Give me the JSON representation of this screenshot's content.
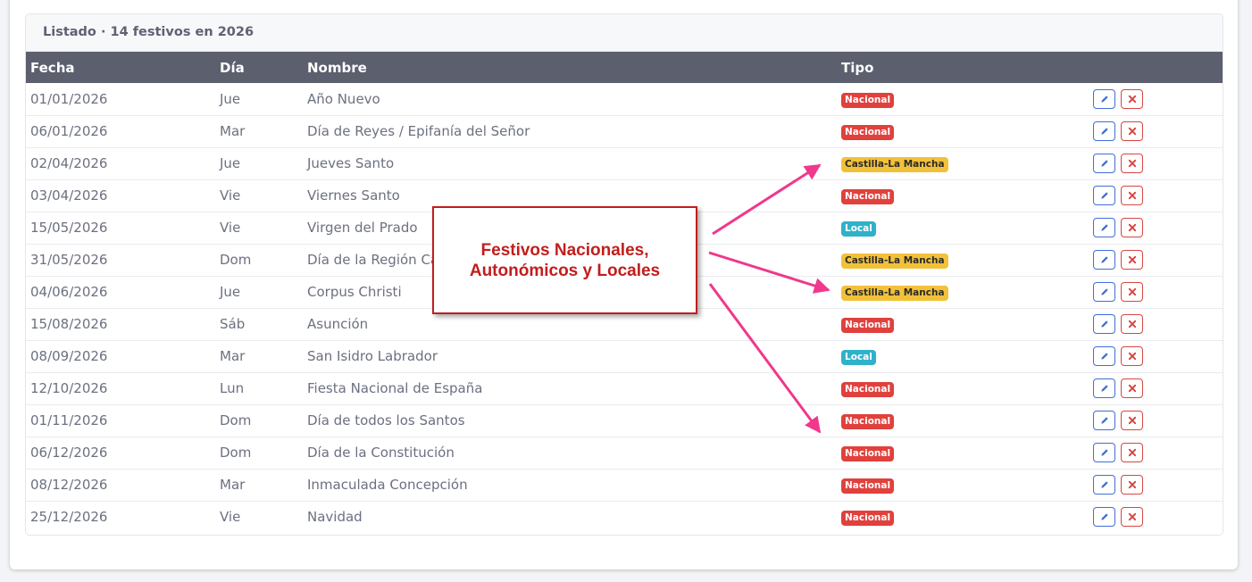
{
  "card": {
    "title": "Listado · 14 festivos en 2026"
  },
  "table": {
    "headers": {
      "fecha": "Fecha",
      "dia": "Día",
      "nombre": "Nombre",
      "tipo": "Tipo"
    },
    "rows": [
      {
        "fecha": "01/01/2026",
        "dia": "Jue",
        "nombre": "Año Nuevo",
        "tipo": "Nacional",
        "tipo_kind": "nacional"
      },
      {
        "fecha": "06/01/2026",
        "dia": "Mar",
        "nombre": "Día de Reyes / Epifanía del Señor",
        "tipo": "Nacional",
        "tipo_kind": "nacional"
      },
      {
        "fecha": "02/04/2026",
        "dia": "Jue",
        "nombre": "Jueves Santo",
        "tipo": "Castilla-La Mancha",
        "tipo_kind": "autonomico"
      },
      {
        "fecha": "03/04/2026",
        "dia": "Vie",
        "nombre": "Viernes Santo",
        "tipo": "Nacional",
        "tipo_kind": "nacional"
      },
      {
        "fecha": "15/05/2026",
        "dia": "Vie",
        "nombre": "Virgen del Prado",
        "tipo": "Local",
        "tipo_kind": "local"
      },
      {
        "fecha": "31/05/2026",
        "dia": "Dom",
        "nombre": "Día de la Región Ca",
        "tipo": "Castilla-La Mancha",
        "tipo_kind": "autonomico"
      },
      {
        "fecha": "04/06/2026",
        "dia": "Jue",
        "nombre": "Corpus Christi",
        "tipo": "Castilla-La Mancha",
        "tipo_kind": "autonomico"
      },
      {
        "fecha": "15/08/2026",
        "dia": "Sáb",
        "nombre": "Asunción",
        "tipo": "Nacional",
        "tipo_kind": "nacional"
      },
      {
        "fecha": "08/09/2026",
        "dia": "Mar",
        "nombre": "San Isidro Labrador",
        "tipo": "Local",
        "tipo_kind": "local"
      },
      {
        "fecha": "12/10/2026",
        "dia": "Lun",
        "nombre": "Fiesta Nacional de España",
        "tipo": "Nacional",
        "tipo_kind": "nacional"
      },
      {
        "fecha": "01/11/2026",
        "dia": "Dom",
        "nombre": "Día de todos los Santos",
        "tipo": "Nacional",
        "tipo_kind": "nacional"
      },
      {
        "fecha": "06/12/2026",
        "dia": "Dom",
        "nombre": "Día de la Constitución",
        "tipo": "Nacional",
        "tipo_kind": "nacional"
      },
      {
        "fecha": "08/12/2026",
        "dia": "Mar",
        "nombre": "Inmaculada Concepción",
        "tipo": "Nacional",
        "tipo_kind": "nacional"
      },
      {
        "fecha": "25/12/2026",
        "dia": "Vie",
        "nombre": "Navidad",
        "tipo": "Nacional",
        "tipo_kind": "nacional"
      }
    ],
    "actions": {
      "edit_icon": "pencil-icon",
      "delete_icon": "x-icon"
    }
  },
  "annotation": {
    "text": "Festivos Nacionales,\nAutonómicos y Locales",
    "color": "#c21d1d",
    "arrow_color": "#f0388c"
  },
  "colors": {
    "nacional": "#e0413d",
    "autonomico": "#f2c13a",
    "local": "#2fb2c9",
    "header_bg": "#5b5f6e"
  }
}
